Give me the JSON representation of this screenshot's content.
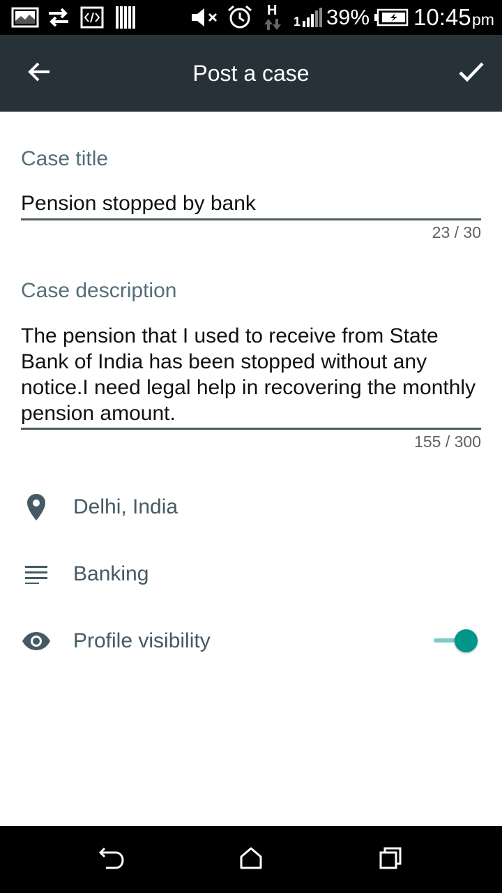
{
  "status_bar": {
    "battery_percent": "39%",
    "time": "10:45",
    "am_pm": "pm",
    "network_type": "H",
    "signal_label": "1",
    "icons": [
      "image-icon",
      "transfer-icon",
      "code-icon",
      "barcode-icon",
      "mute-icon",
      "alarm-icon",
      "data-arrows-icon",
      "signal-icon",
      "battery-charging-icon"
    ]
  },
  "app_bar": {
    "title": "Post a case",
    "back_icon": "arrow-back-icon",
    "confirm_icon": "check-icon",
    "background": "#263238"
  },
  "form": {
    "case_title": {
      "label": "Case title",
      "value": "Pension stopped by bank",
      "counter": "23 / 30"
    },
    "case_description": {
      "label": "Case description",
      "value": "The pension that I used to receive from State Bank of India has been stopped without any notice.I need legal help in recovering the monthly pension amount.",
      "counter": "155 / 300"
    }
  },
  "options": [
    {
      "icon": "location-pin-icon",
      "label": "Delhi, India"
    },
    {
      "icon": "category-lines-icon",
      "label": "Banking"
    },
    {
      "icon": "eye-icon",
      "label": "Profile visibility",
      "toggle_on": true
    }
  ],
  "accent_color": "#009688",
  "nav_bar": {
    "icons": [
      "back-nav-icon",
      "home-nav-icon",
      "recents-nav-icon"
    ]
  }
}
